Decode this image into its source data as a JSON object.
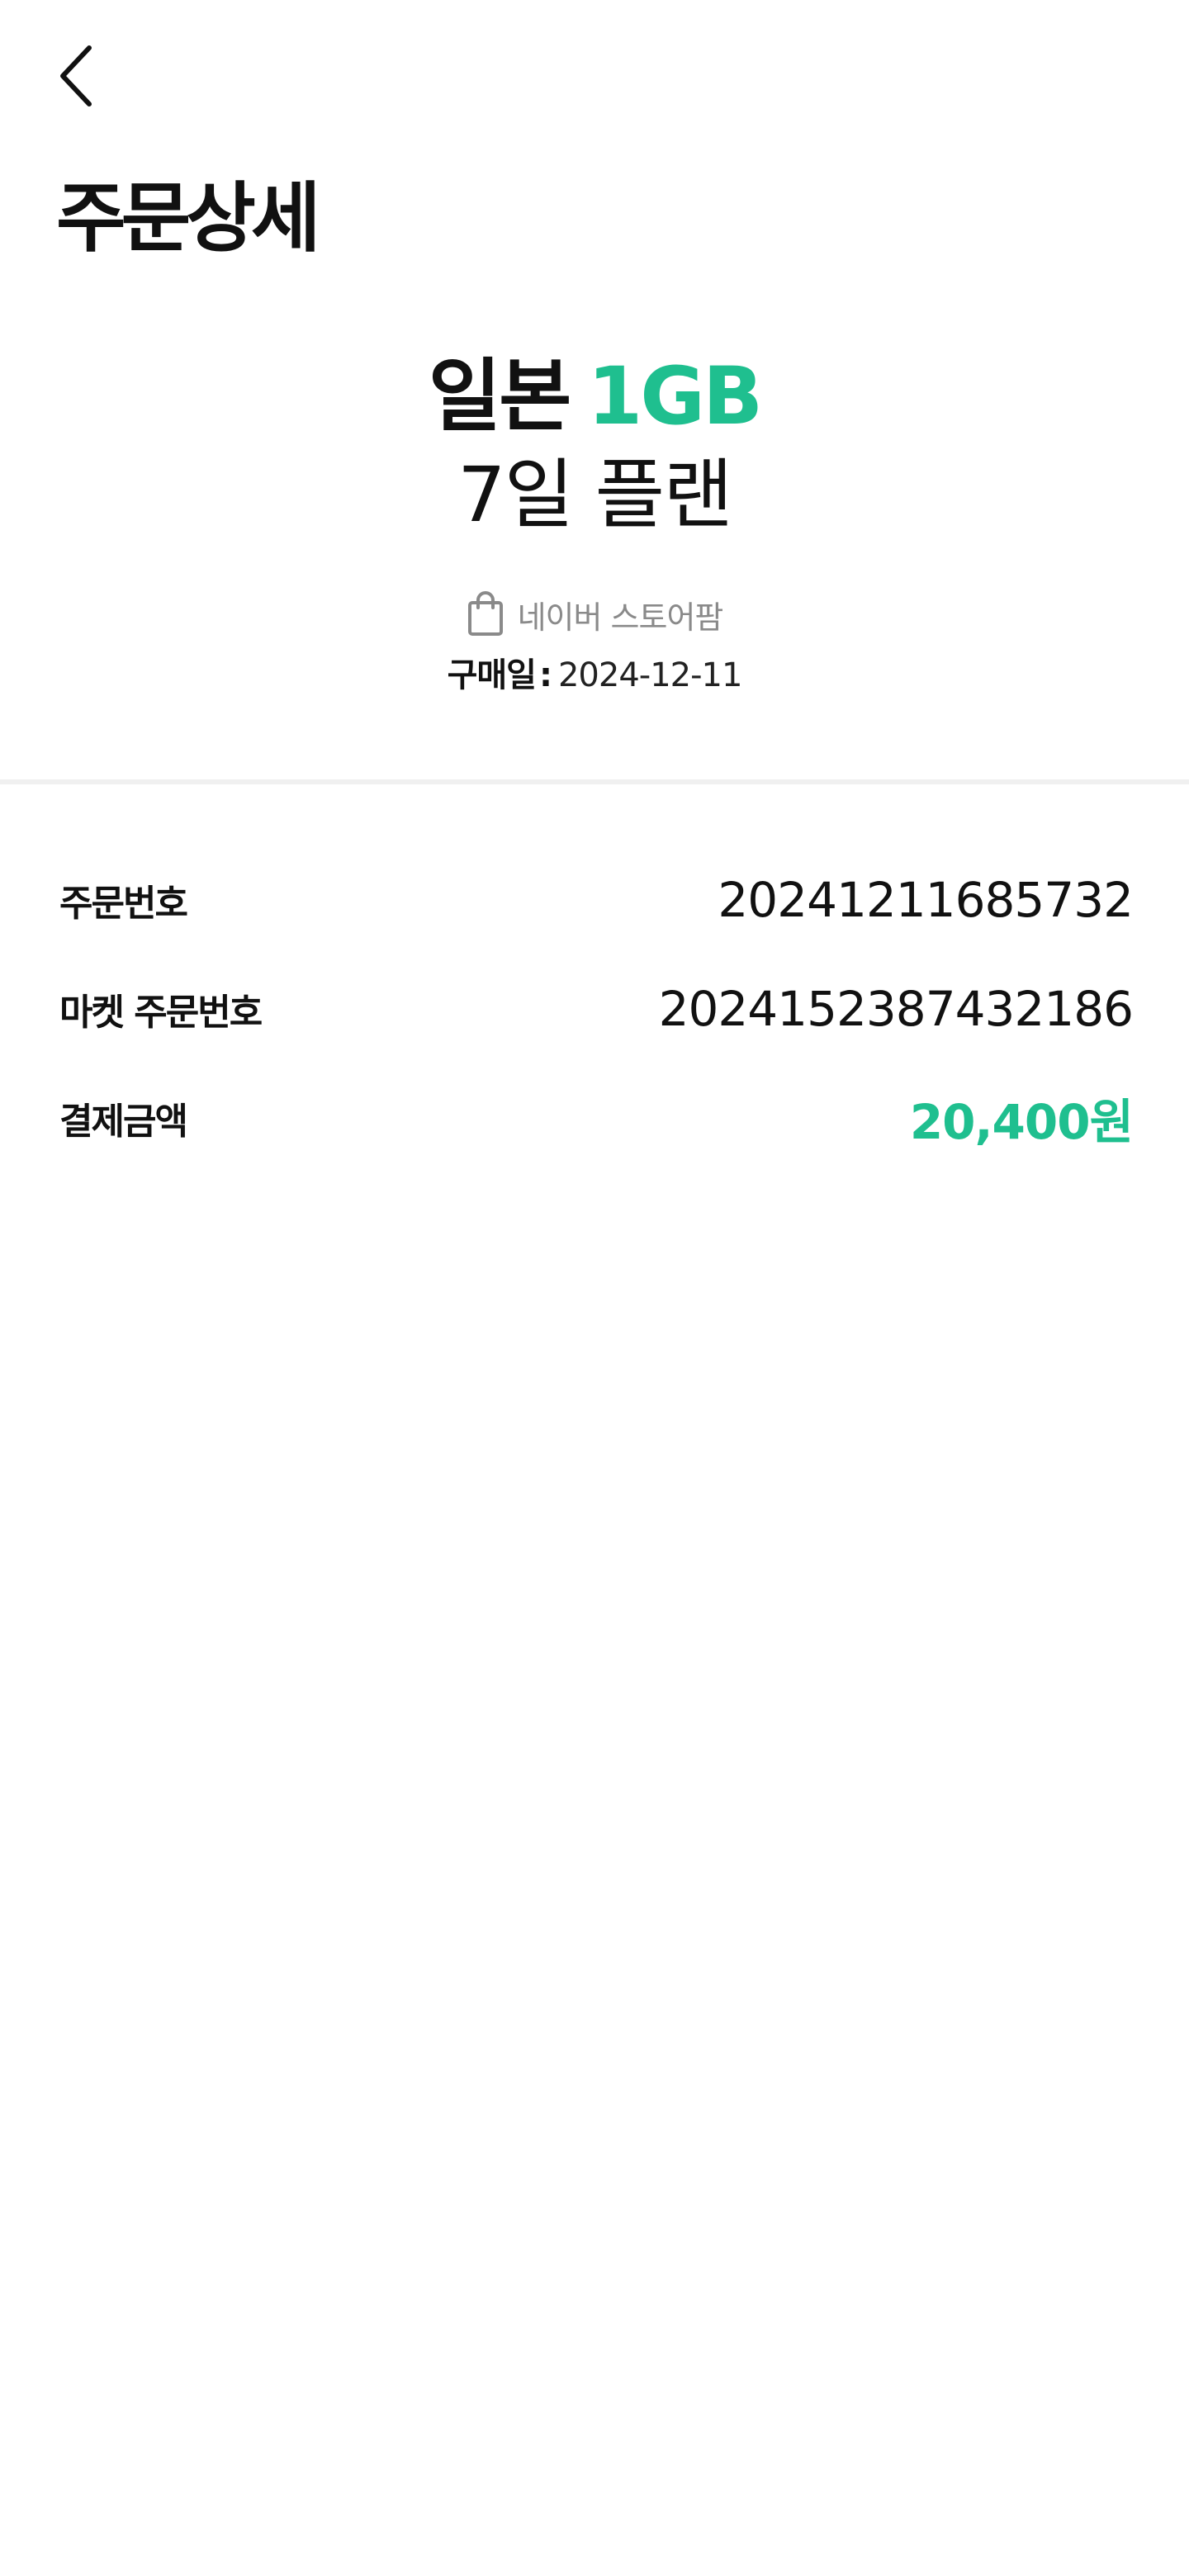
{
  "header": {
    "back_icon": "chevron-left-icon",
    "title": "주문상세"
  },
  "product": {
    "country": "일본",
    "data": "1GB",
    "plan": "7일 플랜",
    "store_icon": "shopping-bag-icon",
    "store_name": "네이버 스토어팜",
    "purchase_label": "구매일",
    "purchase_sep": ":",
    "purchase_date": "2024-12-11"
  },
  "details": {
    "order_number_label": "주문번호",
    "order_number_value": "20241211685732",
    "market_order_label": "마켓 주문번호",
    "market_order_value": "2024152387432186",
    "payment_label": "결제금액",
    "payment_value": "20,400원"
  },
  "colors": {
    "accent": "#1fbf8f",
    "text": "#111111",
    "muted": "#8a8a8a",
    "divider": "#f0f0f0"
  }
}
